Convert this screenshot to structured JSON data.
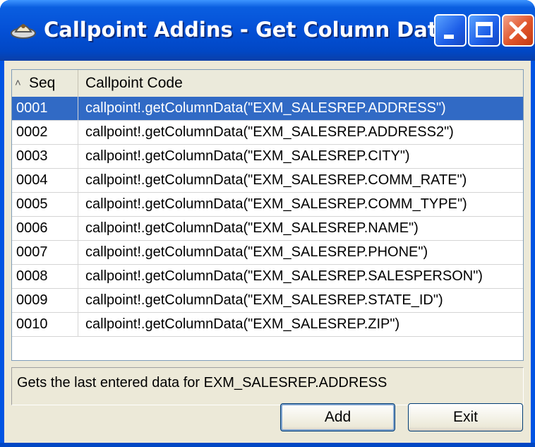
{
  "window": {
    "title": "Callpoint Addins - Get Column Data",
    "accent_color": "#0054e3",
    "buttons": {
      "minimize": "minimize-icon",
      "maximize": "maximize-icon",
      "close": "close-icon"
    }
  },
  "grid": {
    "columns": {
      "seq": "Seq",
      "code": "Callpoint Code"
    },
    "sort_indicator": "sort-ascending-icon",
    "selected_index": 0,
    "selection_color": "#316ac5",
    "rows": [
      {
        "seq": "0001",
        "code": "callpoint!.getColumnData(\"EXM_SALESREP.ADDRESS\")"
      },
      {
        "seq": "0002",
        "code": "callpoint!.getColumnData(\"EXM_SALESREP.ADDRESS2\")"
      },
      {
        "seq": "0003",
        "code": "callpoint!.getColumnData(\"EXM_SALESREP.CITY\")"
      },
      {
        "seq": "0004",
        "code": "callpoint!.getColumnData(\"EXM_SALESREP.COMM_RATE\")"
      },
      {
        "seq": "0005",
        "code": "callpoint!.getColumnData(\"EXM_SALESREP.COMM_TYPE\")"
      },
      {
        "seq": "0006",
        "code": "callpoint!.getColumnData(\"EXM_SALESREP.NAME\")"
      },
      {
        "seq": "0007",
        "code": "callpoint!.getColumnData(\"EXM_SALESREP.PHONE\")"
      },
      {
        "seq": "0008",
        "code": "callpoint!.getColumnData(\"EXM_SALESREP.SALESPERSON\")"
      },
      {
        "seq": "0009",
        "code": "callpoint!.getColumnData(\"EXM_SALESREP.STATE_ID\")"
      },
      {
        "seq": "0010",
        "code": "callpoint!.getColumnData(\"EXM_SALESREP.ZIP\")"
      }
    ]
  },
  "status": {
    "text": "Gets the last entered data for EXM_SALESREP.ADDRESS"
  },
  "actions": {
    "add_label": "Add",
    "exit_label": "Exit"
  }
}
